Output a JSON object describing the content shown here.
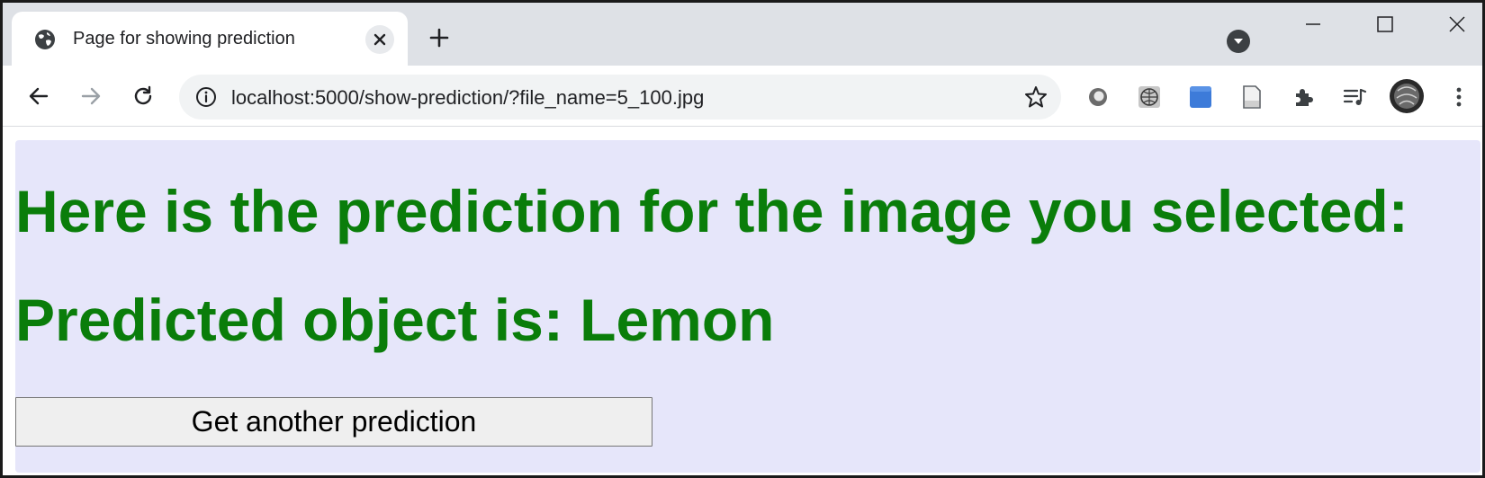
{
  "tab": {
    "title": "Page for showing prediction"
  },
  "address_bar": {
    "url": "localhost:5000/show-prediction/?file_name=5_100.jpg"
  },
  "content": {
    "heading": "Here is the prediction for the image you selected:",
    "prediction": "Predicted object is: Lemon",
    "button_label": "Get another prediction"
  },
  "colors": {
    "heading_text": "#0a7d0a",
    "page_background": "#e6e6fa",
    "tabstrip_background": "#dee1e6"
  },
  "icons": {
    "tab_favicon": "globe-icon",
    "tab_close": "close-icon",
    "new_tab": "plus-icon",
    "profile_dropdown": "chevron-down-icon",
    "back": "arrow-left-icon",
    "forward": "arrow-right-icon",
    "reload": "reload-icon",
    "site_info": "info-icon",
    "bookmark": "star-icon",
    "extensions": [
      "circle-extension-icon",
      "globe-extension-icon",
      "blue-square-extension-icon",
      "document-extension-icon",
      "puzzle-icon",
      "media-playlist-icon",
      "profile-avatar",
      "kebab-menu-icon"
    ]
  }
}
